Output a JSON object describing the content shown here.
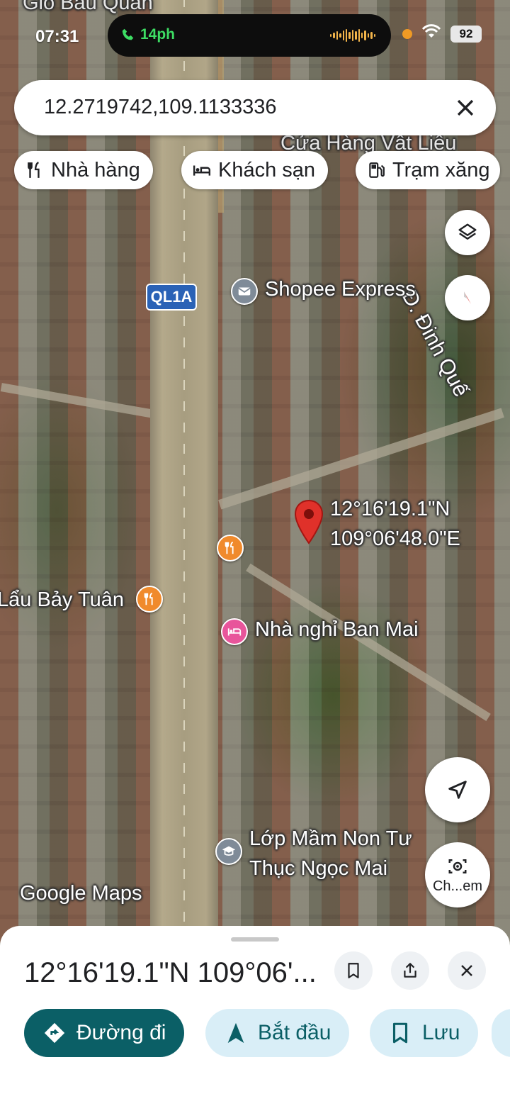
{
  "status_bar": {
    "time": "07:31",
    "call_duration": "14ph",
    "battery": "92"
  },
  "search": {
    "query": "12.2719742,109.1133336"
  },
  "chips": [
    {
      "label": "Nhà hàng",
      "icon": "restaurant-icon"
    },
    {
      "label": "Khách sạn",
      "icon": "hotel-icon"
    },
    {
      "label": "Trạm xăng",
      "icon": "gas-station-icon"
    }
  ],
  "map": {
    "top_labels": {
      "left": "Gió Bấu Quán",
      "right": "Cửa Hàng Vật Liệu"
    },
    "road_shield": "QL1A",
    "street_label": "Đ. Đinh Quế",
    "pois": [
      {
        "name": "Shopee Express",
        "icon": "mail-icon",
        "color": "#7f8b98"
      },
      {
        "name": "Lẩu Bảy Tuân",
        "icon": "restaurant-icon",
        "color": "#f08a2c"
      },
      {
        "name": "Nhà nghỉ Ban Mai",
        "icon": "hotel-icon",
        "color": "#e8559b"
      },
      {
        "name": "Lớp Mầm Non Tư Thục Ngọc Mai",
        "icon": "school-icon",
        "color": "#7f8b98"
      }
    ],
    "pin_coords": {
      "lat": "12°16'19.1\"N",
      "lng": "109°06'48.0\"E"
    },
    "attribution": "Google Maps",
    "lens_label": "Ch...em"
  },
  "sheet": {
    "title": "12°16'19.1\"N 109°06'...",
    "actions": [
      {
        "label": "Đường đi",
        "icon": "directions-icon"
      },
      {
        "label": "Bắt đầu",
        "icon": "navigation-icon"
      },
      {
        "label": "Lưu",
        "icon": "bookmark-icon"
      }
    ],
    "colors": {
      "primary": "#0b5f66",
      "secondary_bg": "#d9eef7",
      "secondary_fg": "#0b5f66"
    }
  }
}
